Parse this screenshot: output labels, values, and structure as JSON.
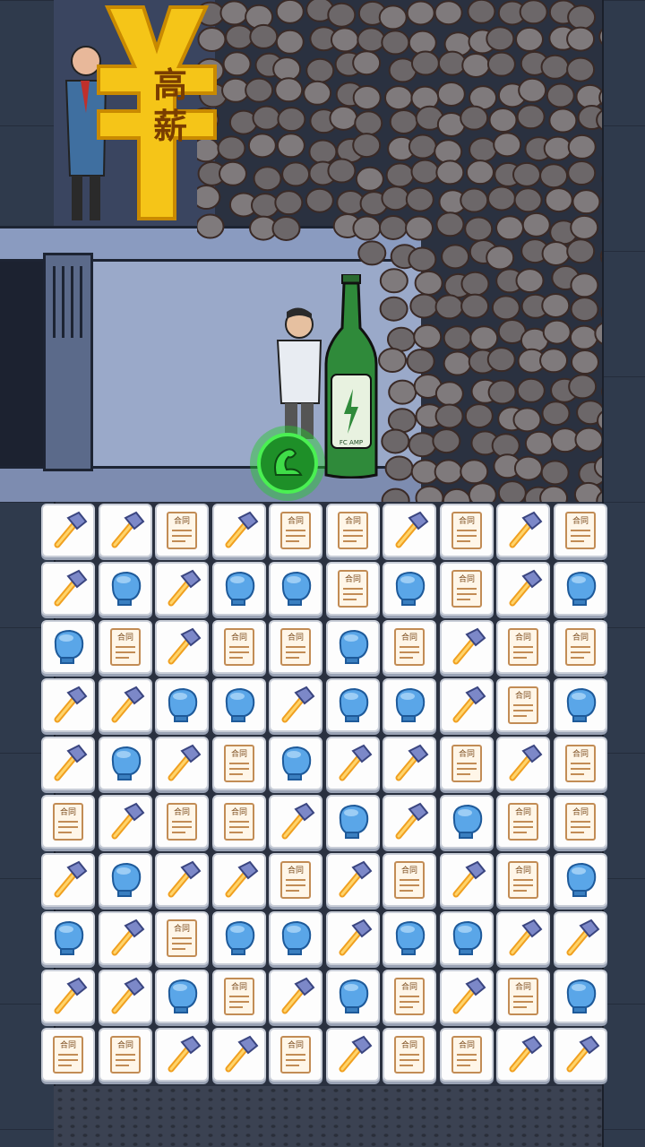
{
  "scene": {
    "sign_text": "高薪",
    "bottle_label": "FC AMP",
    "accent_color": "#f5c518",
    "power_color": "#22c02a"
  },
  "board": {
    "rows": 10,
    "cols": 10,
    "tile_types": {
      "H": "hammer-icon",
      "C": "contract-icon",
      "G": "boxing-glove-icon"
    },
    "contract_label": "合同",
    "grid": [
      [
        "H",
        "H",
        "C",
        "H",
        "C",
        "C",
        "H",
        "C",
        "H",
        "C"
      ],
      [
        "H",
        "G",
        "H",
        "G",
        "G",
        "C",
        "G",
        "C",
        "H",
        "G"
      ],
      [
        "G",
        "C",
        "H",
        "C",
        "C",
        "G",
        "C",
        "H",
        "C",
        "C"
      ],
      [
        "H",
        "H",
        "G",
        "G",
        "H",
        "G",
        "G",
        "H",
        "C",
        "G"
      ],
      [
        "H",
        "G",
        "H",
        "C",
        "G",
        "H",
        "H",
        "C",
        "H",
        "C"
      ],
      [
        "C",
        "H",
        "C",
        "C",
        "H",
        "G",
        "H",
        "G",
        "C",
        "C"
      ],
      [
        "H",
        "G",
        "H",
        "H",
        "C",
        "H",
        "C",
        "H",
        "C",
        "G"
      ],
      [
        "G",
        "H",
        "C",
        "G",
        "G",
        "H",
        "G",
        "G",
        "H",
        "H"
      ],
      [
        "H",
        "H",
        "G",
        "C",
        "H",
        "G",
        "C",
        "H",
        "C",
        "G"
      ],
      [
        "C",
        "C",
        "H",
        "H",
        "C",
        "H",
        "C",
        "C",
        "H",
        "H"
      ]
    ]
  }
}
